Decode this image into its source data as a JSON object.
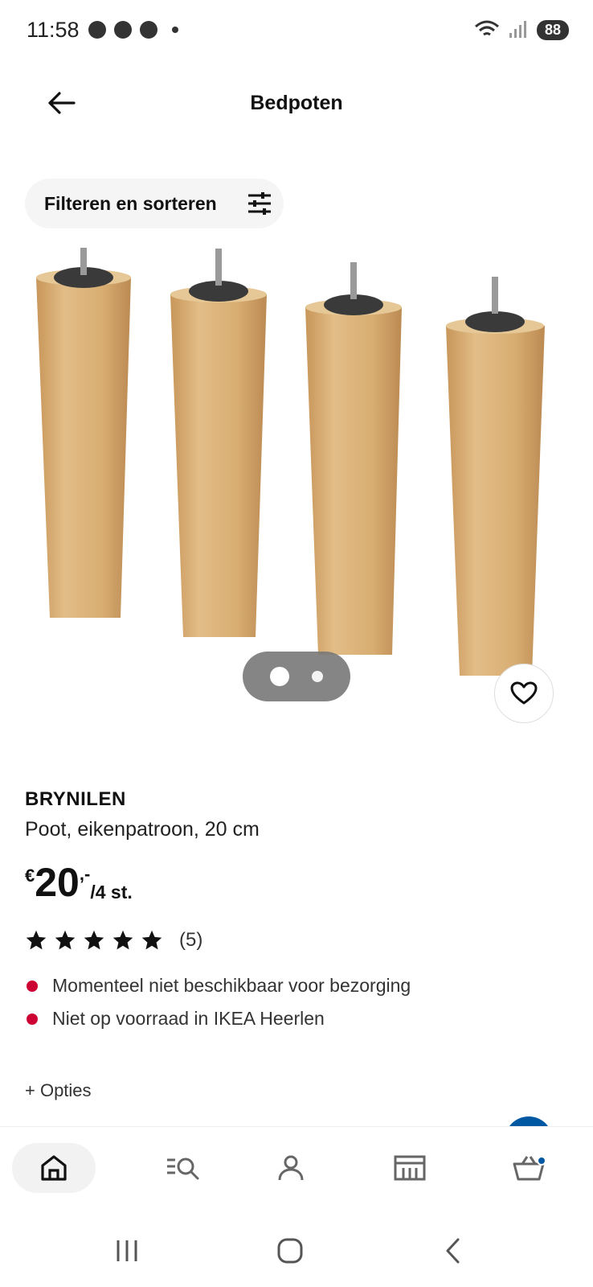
{
  "status_bar": {
    "time": "11:58",
    "battery": "88"
  },
  "header": {
    "title": "Bedpoten"
  },
  "filter": {
    "label": "Filteren en sorteren"
  },
  "product": {
    "brand": "BRYNILEN",
    "description": "Poot, eikenpatroon, 20 cm",
    "price": {
      "currency": "€",
      "amount": "20",
      "decimals": ",-",
      "unit": "/4 st."
    },
    "rating": {
      "stars": 5,
      "count": "(5)"
    },
    "availability": [
      "Momenteel niet beschikbaar voor bezorging",
      "Niet op voorraad in IKEA Heerlen"
    ],
    "options_label": "+ Opties"
  },
  "carousel": {
    "slides": 2,
    "active": 1
  },
  "colors": {
    "accent": "#0058a3",
    "status_red": "#cc0033",
    "wood": "#d9b07a"
  },
  "bottom_nav": [
    {
      "icon": "home-icon",
      "active": true
    },
    {
      "icon": "search-list-icon",
      "active": false
    },
    {
      "icon": "profile-icon",
      "active": false
    },
    {
      "icon": "store-icon",
      "active": false
    },
    {
      "icon": "cart-icon",
      "active": false
    }
  ]
}
